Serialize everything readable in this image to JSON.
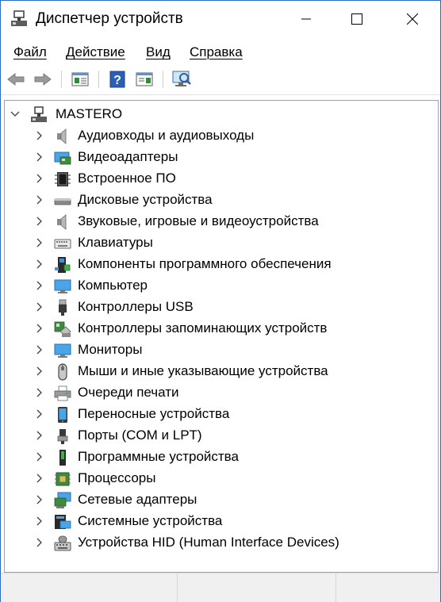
{
  "window": {
    "title": "Диспетчер устройств",
    "minimize_icon": "minimize-icon",
    "maximize_icon": "maximize-icon",
    "close_icon": "close-icon"
  },
  "menu": {
    "items": [
      "Файл",
      "Действие",
      "Вид",
      "Справка"
    ]
  },
  "toolbar": {
    "buttons": [
      "back-arrow-icon",
      "forward-arrow-icon",
      "properties-icon",
      "help-icon",
      "update-driver-icon",
      "scan-hardware-icon"
    ]
  },
  "tree": {
    "root": "MASTERO",
    "categories": [
      {
        "label": "Аудиовходы и аудиовыходы",
        "icon": "audio-io-icon"
      },
      {
        "label": "Видеоадаптеры",
        "icon": "display-adapter-icon"
      },
      {
        "label": "Встроенное ПО",
        "icon": "firmware-icon"
      },
      {
        "label": "Дисковые устройства",
        "icon": "disk-drive-icon"
      },
      {
        "label": "Звуковые, игровые и видеоустройства",
        "icon": "sound-device-icon"
      },
      {
        "label": "Клавиатуры",
        "icon": "keyboard-icon"
      },
      {
        "label": "Компоненты программного обеспечения",
        "icon": "software-component-icon"
      },
      {
        "label": "Компьютер",
        "icon": "computer-icon"
      },
      {
        "label": "Контроллеры USB",
        "icon": "usb-controller-icon"
      },
      {
        "label": "Контроллеры запоминающих устройств",
        "icon": "storage-controller-icon"
      },
      {
        "label": "Мониторы",
        "icon": "monitor-icon"
      },
      {
        "label": "Мыши и иные указывающие устройства",
        "icon": "mouse-icon"
      },
      {
        "label": "Очереди печати",
        "icon": "print-queue-icon"
      },
      {
        "label": "Переносные устройства",
        "icon": "portable-device-icon"
      },
      {
        "label": "Порты (COM и LPT)",
        "icon": "port-icon"
      },
      {
        "label": "Программные устройства",
        "icon": "software-device-icon"
      },
      {
        "label": "Процессоры",
        "icon": "processor-icon"
      },
      {
        "label": "Сетевые адаптеры",
        "icon": "network-adapter-icon"
      },
      {
        "label": "Системные устройства",
        "icon": "system-device-icon"
      },
      {
        "label": "Устройства HID (Human Interface Devices)",
        "icon": "hid-device-icon"
      }
    ]
  },
  "colors": {
    "window_border": "#2b6cc4",
    "icon_blue": "#2f8ad8",
    "status_bg": "#f0f0f0"
  }
}
